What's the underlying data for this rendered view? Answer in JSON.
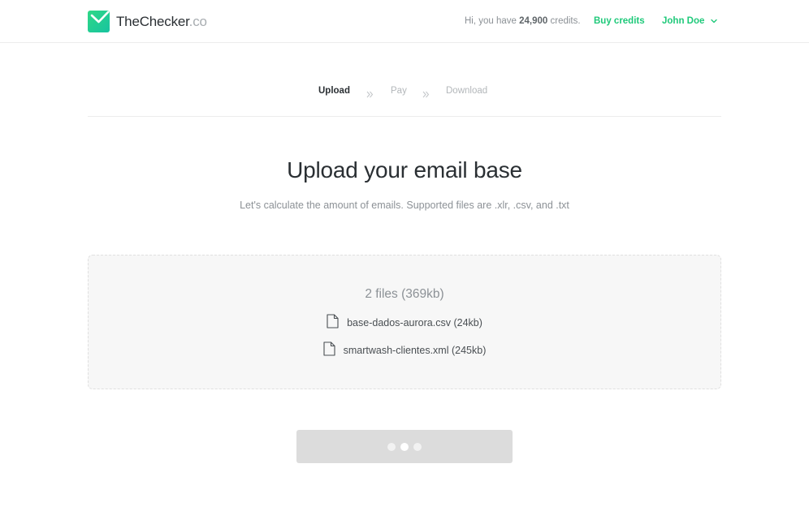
{
  "header": {
    "logo_name": "TheChecker",
    "logo_tld": ".co",
    "credits_prefix": "Hi, you have ",
    "credits_amount": "24,900",
    "credits_suffix": " credits.",
    "buy_credits_label": "Buy credits",
    "user_name": "John Doe",
    "brand_color": "#1fc97a"
  },
  "steps": [
    {
      "label": "Upload",
      "active": true
    },
    {
      "label": "Pay",
      "active": false
    },
    {
      "label": "Download",
      "active": false
    }
  ],
  "main": {
    "title": "Upload your email base",
    "subtitle": "Let's calculate the amount of emails. Supported files are .xlr, .csv, and .txt"
  },
  "dropzone": {
    "summary": "2 files (369kb)",
    "files": [
      {
        "name": "base-dados-aurora.csv",
        "size": "(24kb)"
      },
      {
        "name": "smartwash-clientes.xml",
        "size": "(245kb)"
      }
    ]
  },
  "submit": {
    "state": "loading",
    "icon": "loading-dots"
  }
}
